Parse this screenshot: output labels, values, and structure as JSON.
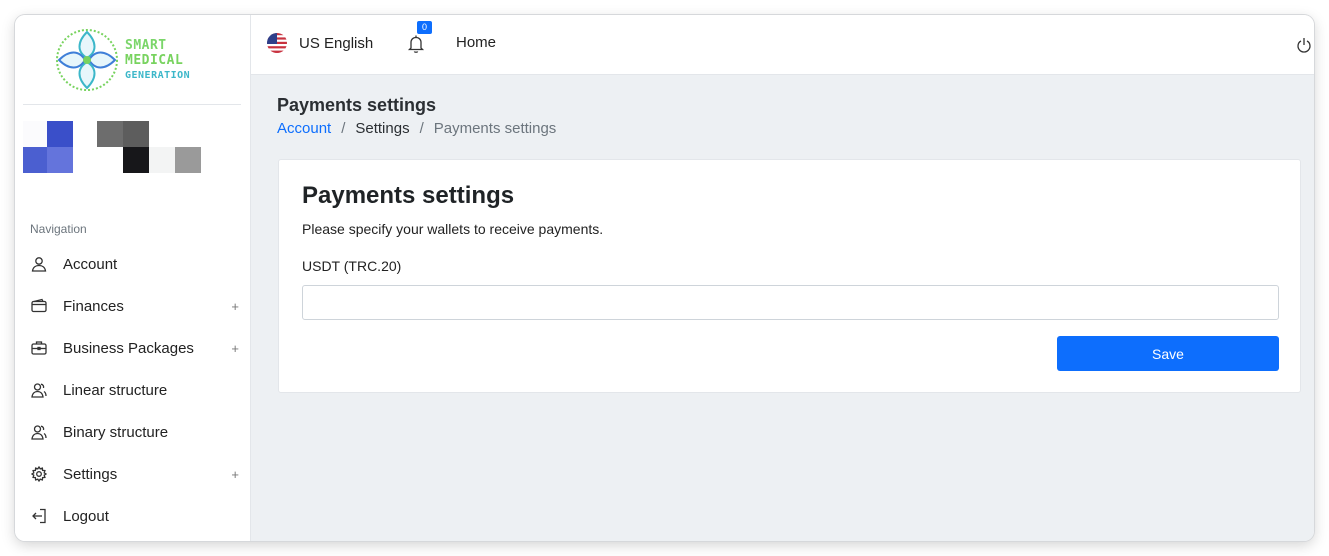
{
  "brand": {
    "line1": "SMART",
    "line2": "MEDICAL",
    "line3": "GENERATION",
    "colors": {
      "green": "#78d35f",
      "teal": "#3cb7c9",
      "blue": "#3f7fd8"
    }
  },
  "sidebar": {
    "caption": "Navigation",
    "items": [
      {
        "label": "Account",
        "icon": "user-icon",
        "expandable": false
      },
      {
        "label": "Finances",
        "icon": "wallet-icon",
        "expandable": true
      },
      {
        "label": "Business Packages",
        "icon": "briefcase-icon",
        "expandable": true
      },
      {
        "label": "Linear structure",
        "icon": "users-icon",
        "expandable": false
      },
      {
        "label": "Binary structure",
        "icon": "users-icon",
        "expandable": false
      },
      {
        "label": "Settings",
        "icon": "gear-icon",
        "expandable": true
      },
      {
        "label": "Logout",
        "icon": "logout-icon",
        "expandable": false
      }
    ],
    "expand_symbol": "+"
  },
  "topbar": {
    "language": "US English",
    "language_icon": "us-flag-icon",
    "notifications_count": "0",
    "home_label": "Home",
    "power_icon": "power-icon"
  },
  "page": {
    "title": "Payments settings",
    "breadcrumb": {
      "root": "Account",
      "middle": "Settings",
      "current": "Payments settings",
      "separator": "/"
    }
  },
  "card": {
    "title": "Payments settings",
    "description": "Please specify your wallets to receive payments.",
    "field_label": "USDT (TRC.20)",
    "field_value": "",
    "save_label": "Save"
  },
  "colors": {
    "accent": "#0d6efd",
    "content_bg": "#edf0f3"
  }
}
